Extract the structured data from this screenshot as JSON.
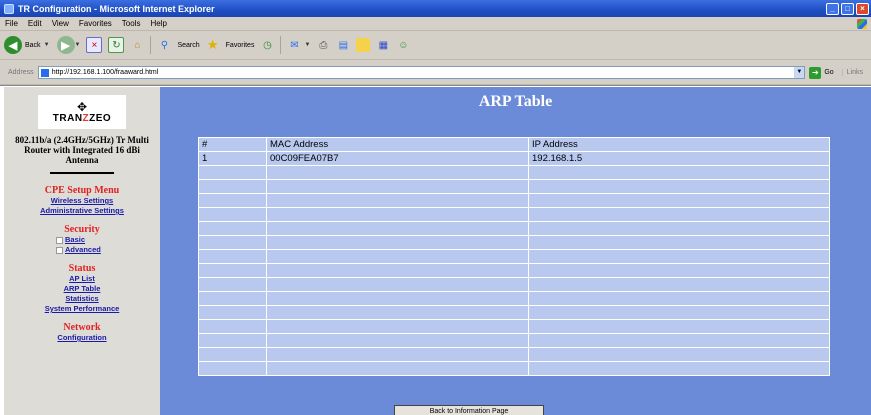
{
  "window": {
    "title": "TR Configuration - Microsoft Internet Explorer",
    "menu": [
      "File",
      "Edit",
      "View",
      "Favorites",
      "Tools",
      "Help"
    ],
    "toolbar": {
      "back": "Back",
      "search": "Search",
      "favorites": "Favorites"
    },
    "address": {
      "label": "Address",
      "url": "http://192.168.1.100/fraaward.html",
      "go": "Go",
      "links": "Links"
    }
  },
  "sidebar": {
    "logo_text_1": "TRAN",
    "logo_text_x": "Z",
    "logo_text_2": "ZEO",
    "device_description": "802.11b/a (2.4GHz/5GHz) Tr Multi Router with Integrated 16 dBi Antenna",
    "cpe_menu_title": "CPE Setup Menu",
    "cpe_links": [
      "Wireless Settings",
      "Administrative Settings"
    ],
    "security_title": "Security",
    "security_links": [
      "Basic",
      "Advanced"
    ],
    "status_title": "Status",
    "status_links": [
      "AP List",
      "ARP Table",
      "Statistics",
      "System Performance"
    ],
    "network_title": "Network",
    "network_links": [
      "Configuration"
    ]
  },
  "main": {
    "page_title": "ARP Table",
    "table": {
      "headers": [
        "#",
        "MAC Address",
        "IP Address"
      ],
      "rows": [
        [
          "1",
          "00C09FEA07B7",
          "192.168.1.5"
        ],
        [
          "",
          "",
          ""
        ],
        [
          "",
          "",
          ""
        ],
        [
          "",
          "",
          ""
        ],
        [
          "",
          "",
          ""
        ],
        [
          "",
          "",
          ""
        ],
        [
          "",
          "",
          ""
        ],
        [
          "",
          "",
          ""
        ],
        [
          "",
          "",
          ""
        ],
        [
          "",
          "",
          ""
        ],
        [
          "",
          "",
          ""
        ],
        [
          "",
          "",
          ""
        ],
        [
          "",
          "",
          ""
        ],
        [
          "",
          "",
          ""
        ],
        [
          "",
          "",
          ""
        ],
        [
          "",
          "",
          ""
        ]
      ]
    },
    "back_button": "Back to Information Page"
  }
}
